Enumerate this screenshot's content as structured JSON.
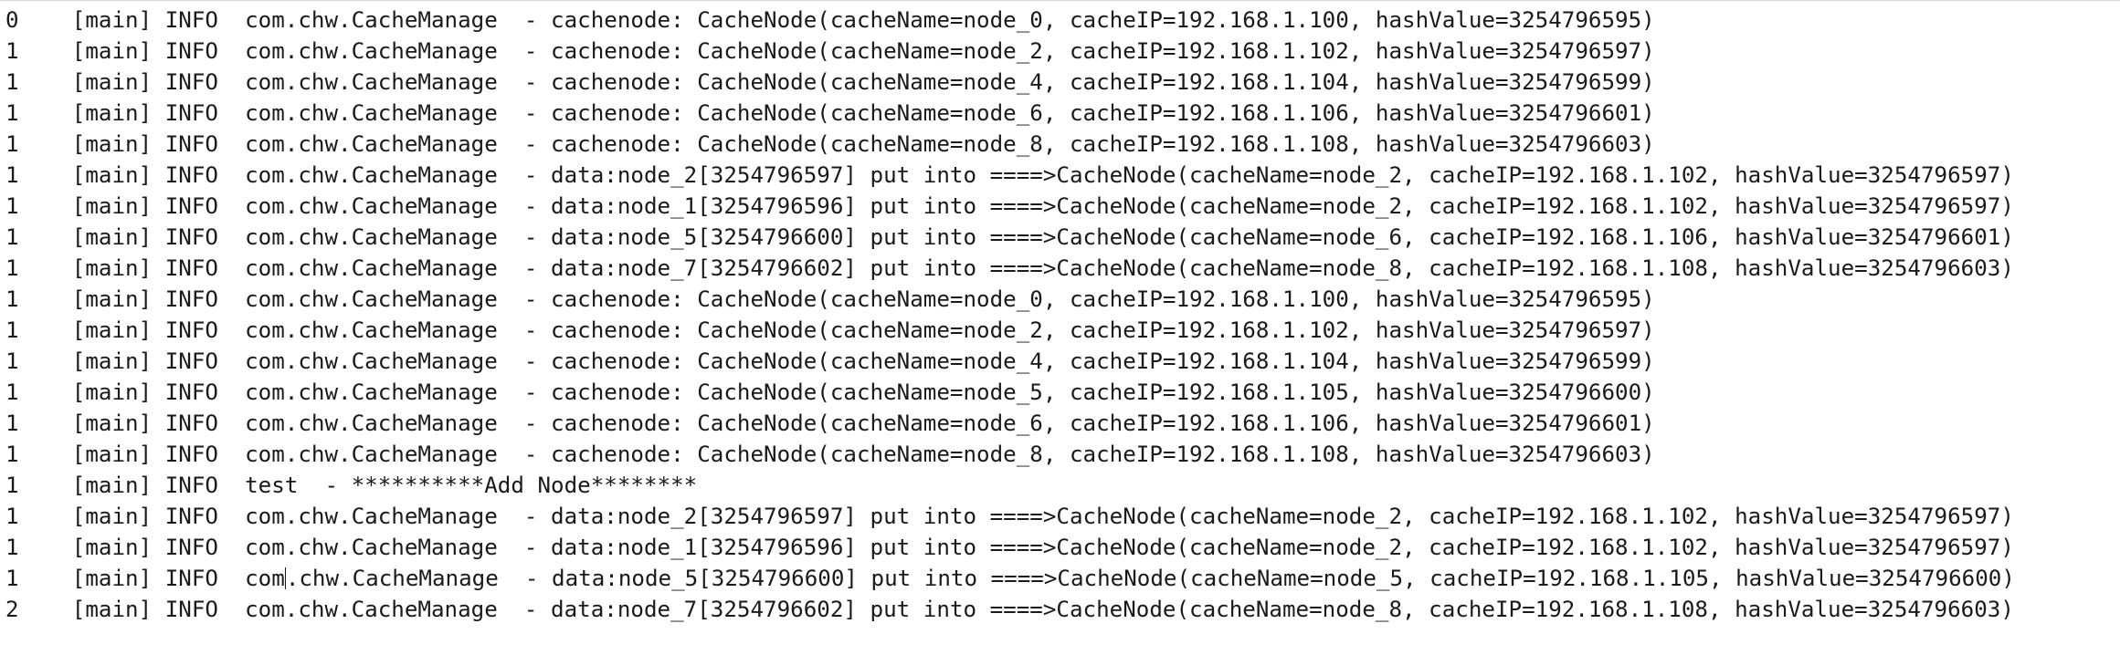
{
  "log": {
    "lines": [
      "0    [main] INFO  com.chw.CacheManage  - cachenode: CacheNode(cacheName=node_0, cacheIP=192.168.1.100, hashValue=3254796595)",
      "1    [main] INFO  com.chw.CacheManage  - cachenode: CacheNode(cacheName=node_2, cacheIP=192.168.1.102, hashValue=3254796597)",
      "1    [main] INFO  com.chw.CacheManage  - cachenode: CacheNode(cacheName=node_4, cacheIP=192.168.1.104, hashValue=3254796599)",
      "1    [main] INFO  com.chw.CacheManage  - cachenode: CacheNode(cacheName=node_6, cacheIP=192.168.1.106, hashValue=3254796601)",
      "1    [main] INFO  com.chw.CacheManage  - cachenode: CacheNode(cacheName=node_8, cacheIP=192.168.1.108, hashValue=3254796603)",
      "1    [main] INFO  com.chw.CacheManage  - data:node_2[3254796597] put into ====>CacheNode(cacheName=node_2, cacheIP=192.168.1.102, hashValue=3254796597)",
      "1    [main] INFO  com.chw.CacheManage  - data:node_1[3254796596] put into ====>CacheNode(cacheName=node_2, cacheIP=192.168.1.102, hashValue=3254796597)",
      "1    [main] INFO  com.chw.CacheManage  - data:node_5[3254796600] put into ====>CacheNode(cacheName=node_6, cacheIP=192.168.1.106, hashValue=3254796601)",
      "1    [main] INFO  com.chw.CacheManage  - data:node_7[3254796602] put into ====>CacheNode(cacheName=node_8, cacheIP=192.168.1.108, hashValue=3254796603)",
      "1    [main] INFO  com.chw.CacheManage  - cachenode: CacheNode(cacheName=node_0, cacheIP=192.168.1.100, hashValue=3254796595)",
      "1    [main] INFO  com.chw.CacheManage  - cachenode: CacheNode(cacheName=node_2, cacheIP=192.168.1.102, hashValue=3254796597)",
      "1    [main] INFO  com.chw.CacheManage  - cachenode: CacheNode(cacheName=node_4, cacheIP=192.168.1.104, hashValue=3254796599)",
      "1    [main] INFO  com.chw.CacheManage  - cachenode: CacheNode(cacheName=node_5, cacheIP=192.168.1.105, hashValue=3254796600)",
      "1    [main] INFO  com.chw.CacheManage  - cachenode: CacheNode(cacheName=node_6, cacheIP=192.168.1.106, hashValue=3254796601)",
      "1    [main] INFO  com.chw.CacheManage  - cachenode: CacheNode(cacheName=node_8, cacheIP=192.168.1.108, hashValue=3254796603)",
      "1    [main] INFO  test  - **********Add Node********",
      "1    [main] INFO  com.chw.CacheManage  - data:node_2[3254796597] put into ====>CacheNode(cacheName=node_2, cacheIP=192.168.1.102, hashValue=3254796597)",
      "1    [main] INFO  com.chw.CacheManage  - data:node_1[3254796596] put into ====>CacheNode(cacheName=node_2, cacheIP=192.168.1.102, hashValue=3254796597)",
      "1    [main] INFO  com.chw.CacheManage  - data:node_5[3254796600] put into ====>CacheNode(cacheName=node_5, cacheIP=192.168.1.105, hashValue=3254796600)",
      "2    [main] INFO  com.chw.CacheManage  - data:node_7[3254796602] put into ====>CacheNode(cacheName=node_8, cacheIP=192.168.1.108, hashValue=3254796603)"
    ],
    "caret_line": 18,
    "caret_column": 21
  }
}
